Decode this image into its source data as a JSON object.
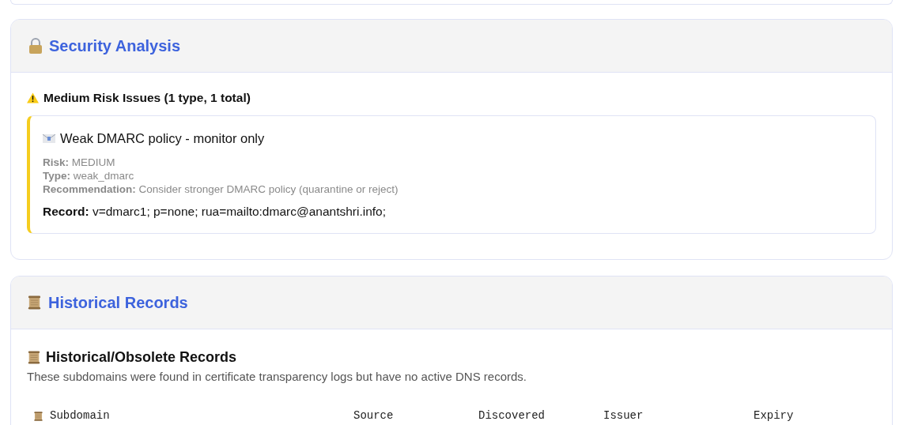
{
  "security": {
    "title": "Security Analysis",
    "group_heading": "Medium Risk Issues (1 type, 1 total)",
    "issues": [
      {
        "title": "Weak DMARC policy - monitor only",
        "fields": [
          {
            "kind": "detail",
            "label": "Risk:",
            "value": "MEDIUM"
          },
          {
            "kind": "detail",
            "label": "Type:",
            "value": "weak_dmarc"
          },
          {
            "kind": "detail",
            "label": "Recommendation:",
            "value": "Consider stronger DMARC policy (quarantine or reject)"
          },
          {
            "kind": "record",
            "label": "Record:",
            "value": "v=dmarc1; p=none; rua=mailto:dmarc@anantshri.info;"
          }
        ]
      }
    ]
  },
  "historical": {
    "title": "Historical Records",
    "subheading": "Historical/Obsolete Records",
    "description": "These subdomains were found in certificate transparency logs but have no active DNS records.",
    "table": {
      "columns": [
        "Subdomain",
        "Source",
        "Discovered",
        "Issuer",
        "Expiry"
      ]
    }
  }
}
